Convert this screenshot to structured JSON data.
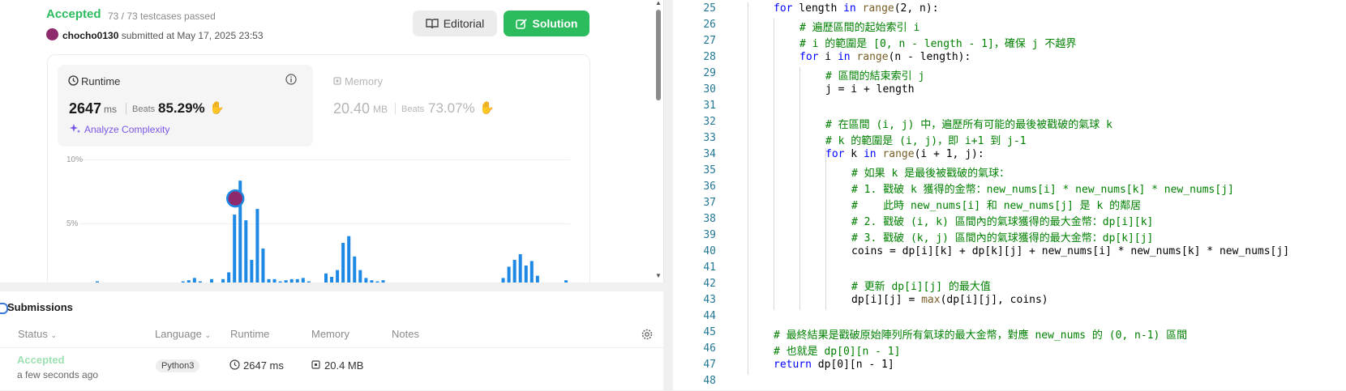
{
  "result": {
    "status": "Accepted",
    "testcases": "73 / 73 testcases passed",
    "username": "chocho0130",
    "submitted_text": "submitted at May 17, 2025 23:53",
    "editorial_label": "Editorial",
    "solution_label": "Solution"
  },
  "runtime": {
    "label": "Runtime",
    "value": "2647",
    "unit": "ms",
    "beats_label": "Beats",
    "beats_value": "85.29%",
    "analyze_label": "Analyze Complexity"
  },
  "memory": {
    "label": "Memory",
    "value": "20.40",
    "unit": "MB",
    "beats_label": "Beats",
    "beats_value": "73.07%"
  },
  "chart_data": {
    "type": "bar",
    "yticks": [
      "10%",
      "5%"
    ],
    "ylim": [
      0,
      10
    ],
    "values": [
      0.1,
      0,
      0,
      0,
      0,
      0,
      0,
      0,
      0,
      0,
      0,
      0,
      0,
      0,
      0,
      0.1,
      0.2,
      0.4,
      0.1,
      0,
      0.3,
      0,
      0.3,
      0.9,
      6,
      9,
      5.5,
      2,
      6.5,
      3,
      0.3,
      0.3,
      0.1,
      0.2,
      0.3,
      0.3,
      0.4,
      0.1,
      0,
      0,
      0.8,
      0.5,
      1.1,
      3.5,
      4.1,
      2.3,
      1.1,
      0.4,
      0.2,
      0.1,
      0.2,
      0,
      0,
      0,
      0,
      0,
      0,
      0,
      0,
      0,
      0,
      0,
      0,
      0,
      0,
      0,
      0,
      0,
      0,
      0,
      0,
      0.4,
      1.4,
      2,
      2.5,
      1.5,
      1.9,
      0.6,
      0,
      0,
      0,
      0,
      0.2,
      0.6,
      2,
      3.8,
      4,
      3.6
    ],
    "highlight_index": 25
  },
  "submissions": {
    "title": "Submissions",
    "columns": [
      "Status",
      "Language",
      "Runtime",
      "Memory",
      "Notes"
    ],
    "row": {
      "status": "Accepted",
      "time": "a few seconds ago",
      "language": "Python3",
      "runtime": "2647 ms",
      "memory": "20.4 MB"
    }
  },
  "code_lines": [
    {
      "n": "25",
      "indent": 0,
      "t": "for length in range(2, n):"
    },
    {
      "n": "26",
      "indent": 1,
      "t": "# 遍歷區間的起始索引 i"
    },
    {
      "n": "27",
      "indent": 1,
      "t": "# i 的範圍是 [0, n - length - 1]，確保 j 不越界"
    },
    {
      "n": "28",
      "indent": 1,
      "t": "for i in range(n - length):"
    },
    {
      "n": "29",
      "indent": 2,
      "t": "# 區間的結束索引 j"
    },
    {
      "n": "30",
      "indent": 2,
      "t": "j = i + length"
    },
    {
      "n": "31",
      "indent": 0,
      "t": ""
    },
    {
      "n": "32",
      "indent": 2,
      "t": "# 在區間 (i, j) 中，遍歷所有可能的最後被戳破的氣球 k"
    },
    {
      "n": "33",
      "indent": 2,
      "t": "# k 的範圍是 (i, j)，即 i+1 到 j-1"
    },
    {
      "n": "34",
      "indent": 2,
      "t": "for k in range(i + 1, j):"
    },
    {
      "n": "35",
      "indent": 3,
      "t": "# 如果 k 是最後被戳破的氣球："
    },
    {
      "n": "36",
      "indent": 3,
      "t": "# 1. 戳破 k 獲得的金幣：new_nums[i] * new_nums[k] * new_nums[j]"
    },
    {
      "n": "37",
      "indent": 3,
      "t": "#    此時 new_nums[i] 和 new_nums[j] 是 k 的鄰居"
    },
    {
      "n": "38",
      "indent": 3,
      "t": "# 2. 戳破 (i, k) 區間內的氣球獲得的最大金幣：dp[i][k]"
    },
    {
      "n": "39",
      "indent": 3,
      "t": "# 3. 戳破 (k, j) 區間內的氣球獲得的最大金幣：dp[k][j]"
    },
    {
      "n": "40",
      "indent": 3,
      "t": "coins = dp[i][k] + dp[k][j] + new_nums[i] * new_nums[k] * new_nums[j]"
    },
    {
      "n": "41",
      "indent": 0,
      "t": ""
    },
    {
      "n": "42",
      "indent": 3,
      "t": "# 更新 dp[i][j] 的最大值"
    },
    {
      "n": "43",
      "indent": 3,
      "t": "dp[i][j] = max(dp[i][j], coins)"
    },
    {
      "n": "44",
      "indent": 0,
      "t": ""
    },
    {
      "n": "45",
      "indent": 0,
      "t": "# 最終結果是戳破原始陣列所有氣球的最大金幣，對應 new_nums 的 (0, n-1) 區間"
    },
    {
      "n": "46",
      "indent": 0,
      "t": "# 也就是 dp[0][n - 1]"
    },
    {
      "n": "47",
      "indent": 0,
      "t": "return dp[0][n - 1]"
    },
    {
      "n": "48",
      "indent": 0,
      "t": ""
    }
  ],
  "colors": {
    "accepted": "#2cbb5d",
    "bar": "#1e88e5",
    "line_number": "#237893",
    "comment": "#008000",
    "keyword": "#0000ff"
  }
}
